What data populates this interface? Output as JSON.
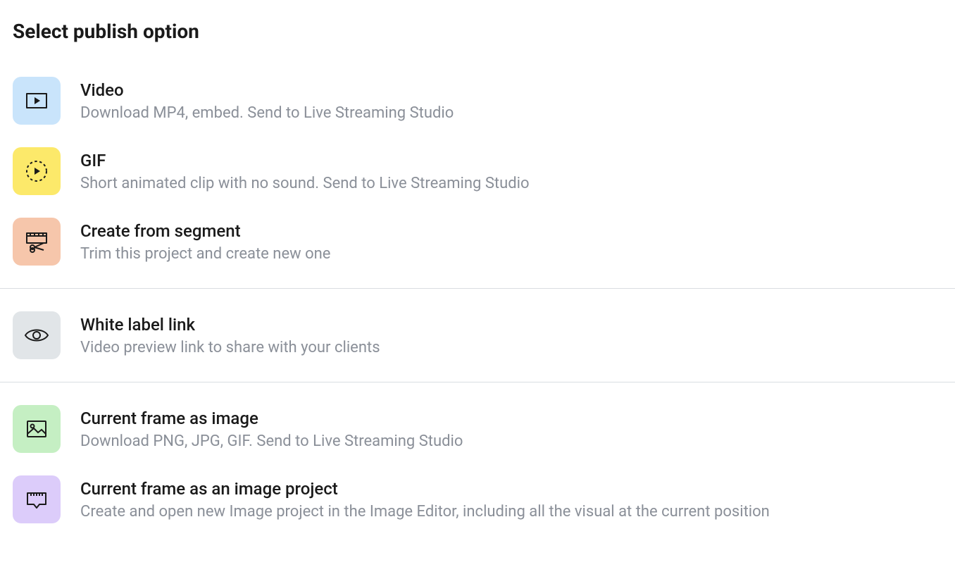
{
  "heading": "Select publish option",
  "groups": [
    [
      {
        "title": "Video",
        "desc": "Download MP4, embed. Send to Live Streaming Studio"
      },
      {
        "title": "GIF",
        "desc": "Short animated clip with no sound. Send to Live Streaming Studio"
      },
      {
        "title": "Create from segment",
        "desc": "Trim this project and create new one"
      }
    ],
    [
      {
        "title": "White label link",
        "desc": "Video preview link to share with your clients"
      }
    ],
    [
      {
        "title": "Current frame as image",
        "desc": "Download PNG, JPG, GIF. Send to Live Streaming Studio"
      },
      {
        "title": "Current frame as an image project",
        "desc": "Create and open new Image project in the Image Editor, including all the visual at the current position"
      }
    ]
  ]
}
